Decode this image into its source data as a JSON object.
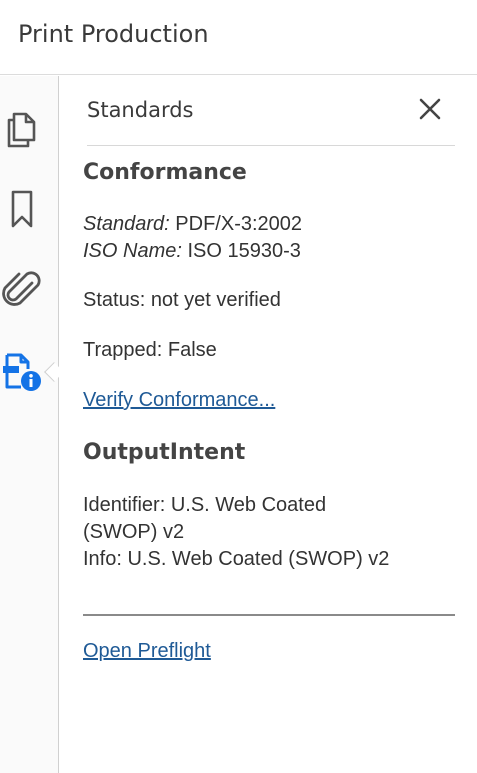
{
  "app": {
    "title": "Print Production"
  },
  "rail": {
    "items": [
      {
        "name": "pages-icon"
      },
      {
        "name": "bookmark-icon"
      },
      {
        "name": "attachment-icon"
      },
      {
        "name": "standards-icon",
        "active": true
      }
    ],
    "active_color": "#1473e6"
  },
  "panel": {
    "title": "Standards",
    "close_icon": "close-icon"
  },
  "conformance": {
    "heading": "Conformance",
    "standard_label": "Standard:",
    "standard_value": "PDF/X-3:2002",
    "iso_label": "ISO Name:",
    "iso_value": "ISO 15930-3",
    "status": "Status: not yet verified",
    "trapped": "Trapped: False",
    "verify_link": "Verify Conformance..."
  },
  "output_intent": {
    "heading": "OutputIntent",
    "identifier_line1": "Identifier: U.S. Web Coated",
    "identifier_line2": "(SWOP) v2",
    "info": "Info: U.S. Web Coated (SWOP) v2"
  },
  "preflight_link": "Open Preflight"
}
